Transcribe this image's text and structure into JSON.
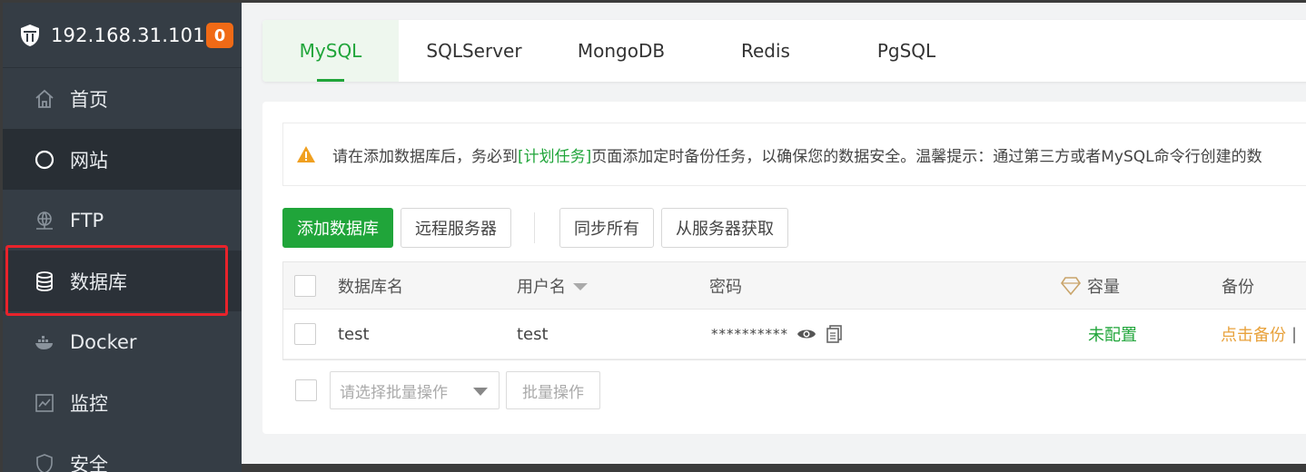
{
  "sidebar": {
    "server_ip": "192.168.31.101",
    "badge_count": "0",
    "items": [
      {
        "label": "首页",
        "icon": "home-icon"
      },
      {
        "label": "网站",
        "icon": "globe-icon"
      },
      {
        "label": "FTP",
        "icon": "ftp-icon"
      },
      {
        "label": "数据库",
        "icon": "database-icon"
      },
      {
        "label": "Docker",
        "icon": "docker-icon"
      },
      {
        "label": "监控",
        "icon": "monitor-icon"
      },
      {
        "label": "安全",
        "icon": "security-icon"
      }
    ]
  },
  "tabs": [
    {
      "label": "MySQL",
      "active": true
    },
    {
      "label": "SQLServer"
    },
    {
      "label": "MongoDB"
    },
    {
      "label": "Redis"
    },
    {
      "label": "PgSQL"
    }
  ],
  "notice": {
    "prefix": "请在添加数据库后，务必到",
    "link": "[计划任务]",
    "suffix": "页面添加定时备份任务，以确保您的数据安全。温馨提示：通过第三方或者MySQL命令行创建的数"
  },
  "toolbar": {
    "add_db": "添加数据库",
    "remote_server": "远程服务器",
    "sync_all": "同步所有",
    "fetch_from_server": "从服务器获取"
  },
  "table": {
    "columns": {
      "name": "数据库名",
      "user": "用户名",
      "password": "密码",
      "capacity": "容量",
      "backup": "备份"
    },
    "rows": [
      {
        "name": "test",
        "user": "test",
        "password": "**********",
        "capacity": "未配置",
        "backup": "点击备份",
        "separator": "|"
      }
    ]
  },
  "batch": {
    "select_placeholder": "请选择批量操作",
    "button": "批量操作"
  },
  "colors": {
    "accent": "#20a53a",
    "badge": "#f06a16",
    "warning": "#f0a020",
    "highlight": "#e8232b",
    "backup_link": "#e8a23c"
  }
}
